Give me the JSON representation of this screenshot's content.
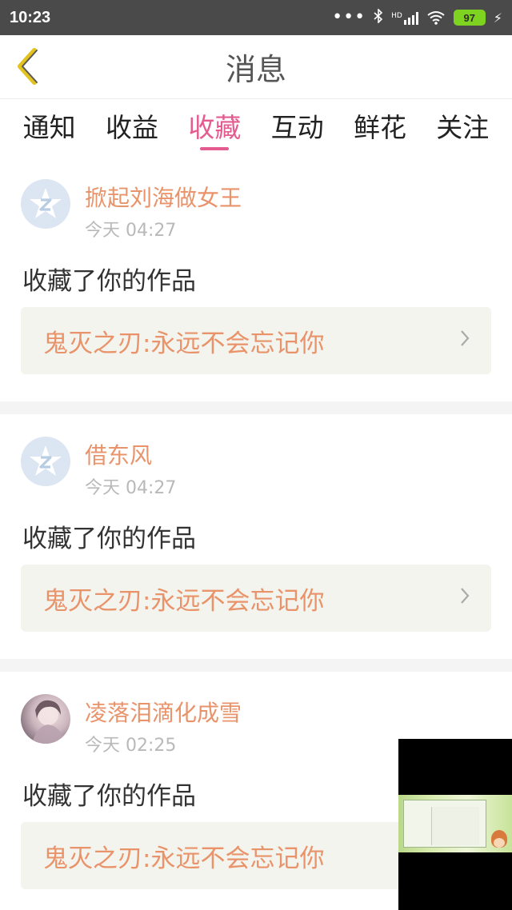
{
  "status_bar": {
    "time": "10:23",
    "dots": "•••",
    "hd_label": "HD",
    "battery": "97",
    "icons": [
      "bluetooth-icon",
      "signal-icon",
      "wifi-icon",
      "battery-icon",
      "charging-icon"
    ]
  },
  "header": {
    "title": "消息",
    "back_icon": "chevron-left-icon",
    "accent_color": "#e4c21f"
  },
  "tabs": [
    {
      "label": "通知",
      "active": false
    },
    {
      "label": "收益",
      "active": false
    },
    {
      "label": "收藏",
      "active": true
    },
    {
      "label": "互动",
      "active": false
    },
    {
      "label": "鲜花",
      "active": false
    },
    {
      "label": "关注",
      "active": false
    }
  ],
  "colors": {
    "tab_active": "#e45b8f",
    "username": "#e9936b",
    "work_title": "#e9936b",
    "time": "#b9b9b9"
  },
  "messages": [
    {
      "username": "掀起刘海做女王",
      "time": "今天 04:27",
      "action": "收藏了你的作品",
      "work_title": "鬼灭之刃:永远不会忘记你",
      "avatar": "default-avatar-icon"
    },
    {
      "username": "借东风",
      "time": "今天 04:27",
      "action": "收藏了你的作品",
      "work_title": "鬼灭之刃:永远不会忘记你",
      "avatar": "default-avatar-icon"
    },
    {
      "username": "凌落泪滴化成雪",
      "time": "今天 02:25",
      "action": "收藏了你的作品",
      "work_title": "鬼灭之刃:永远不会忘记你",
      "avatar": "photo-avatar"
    }
  ]
}
